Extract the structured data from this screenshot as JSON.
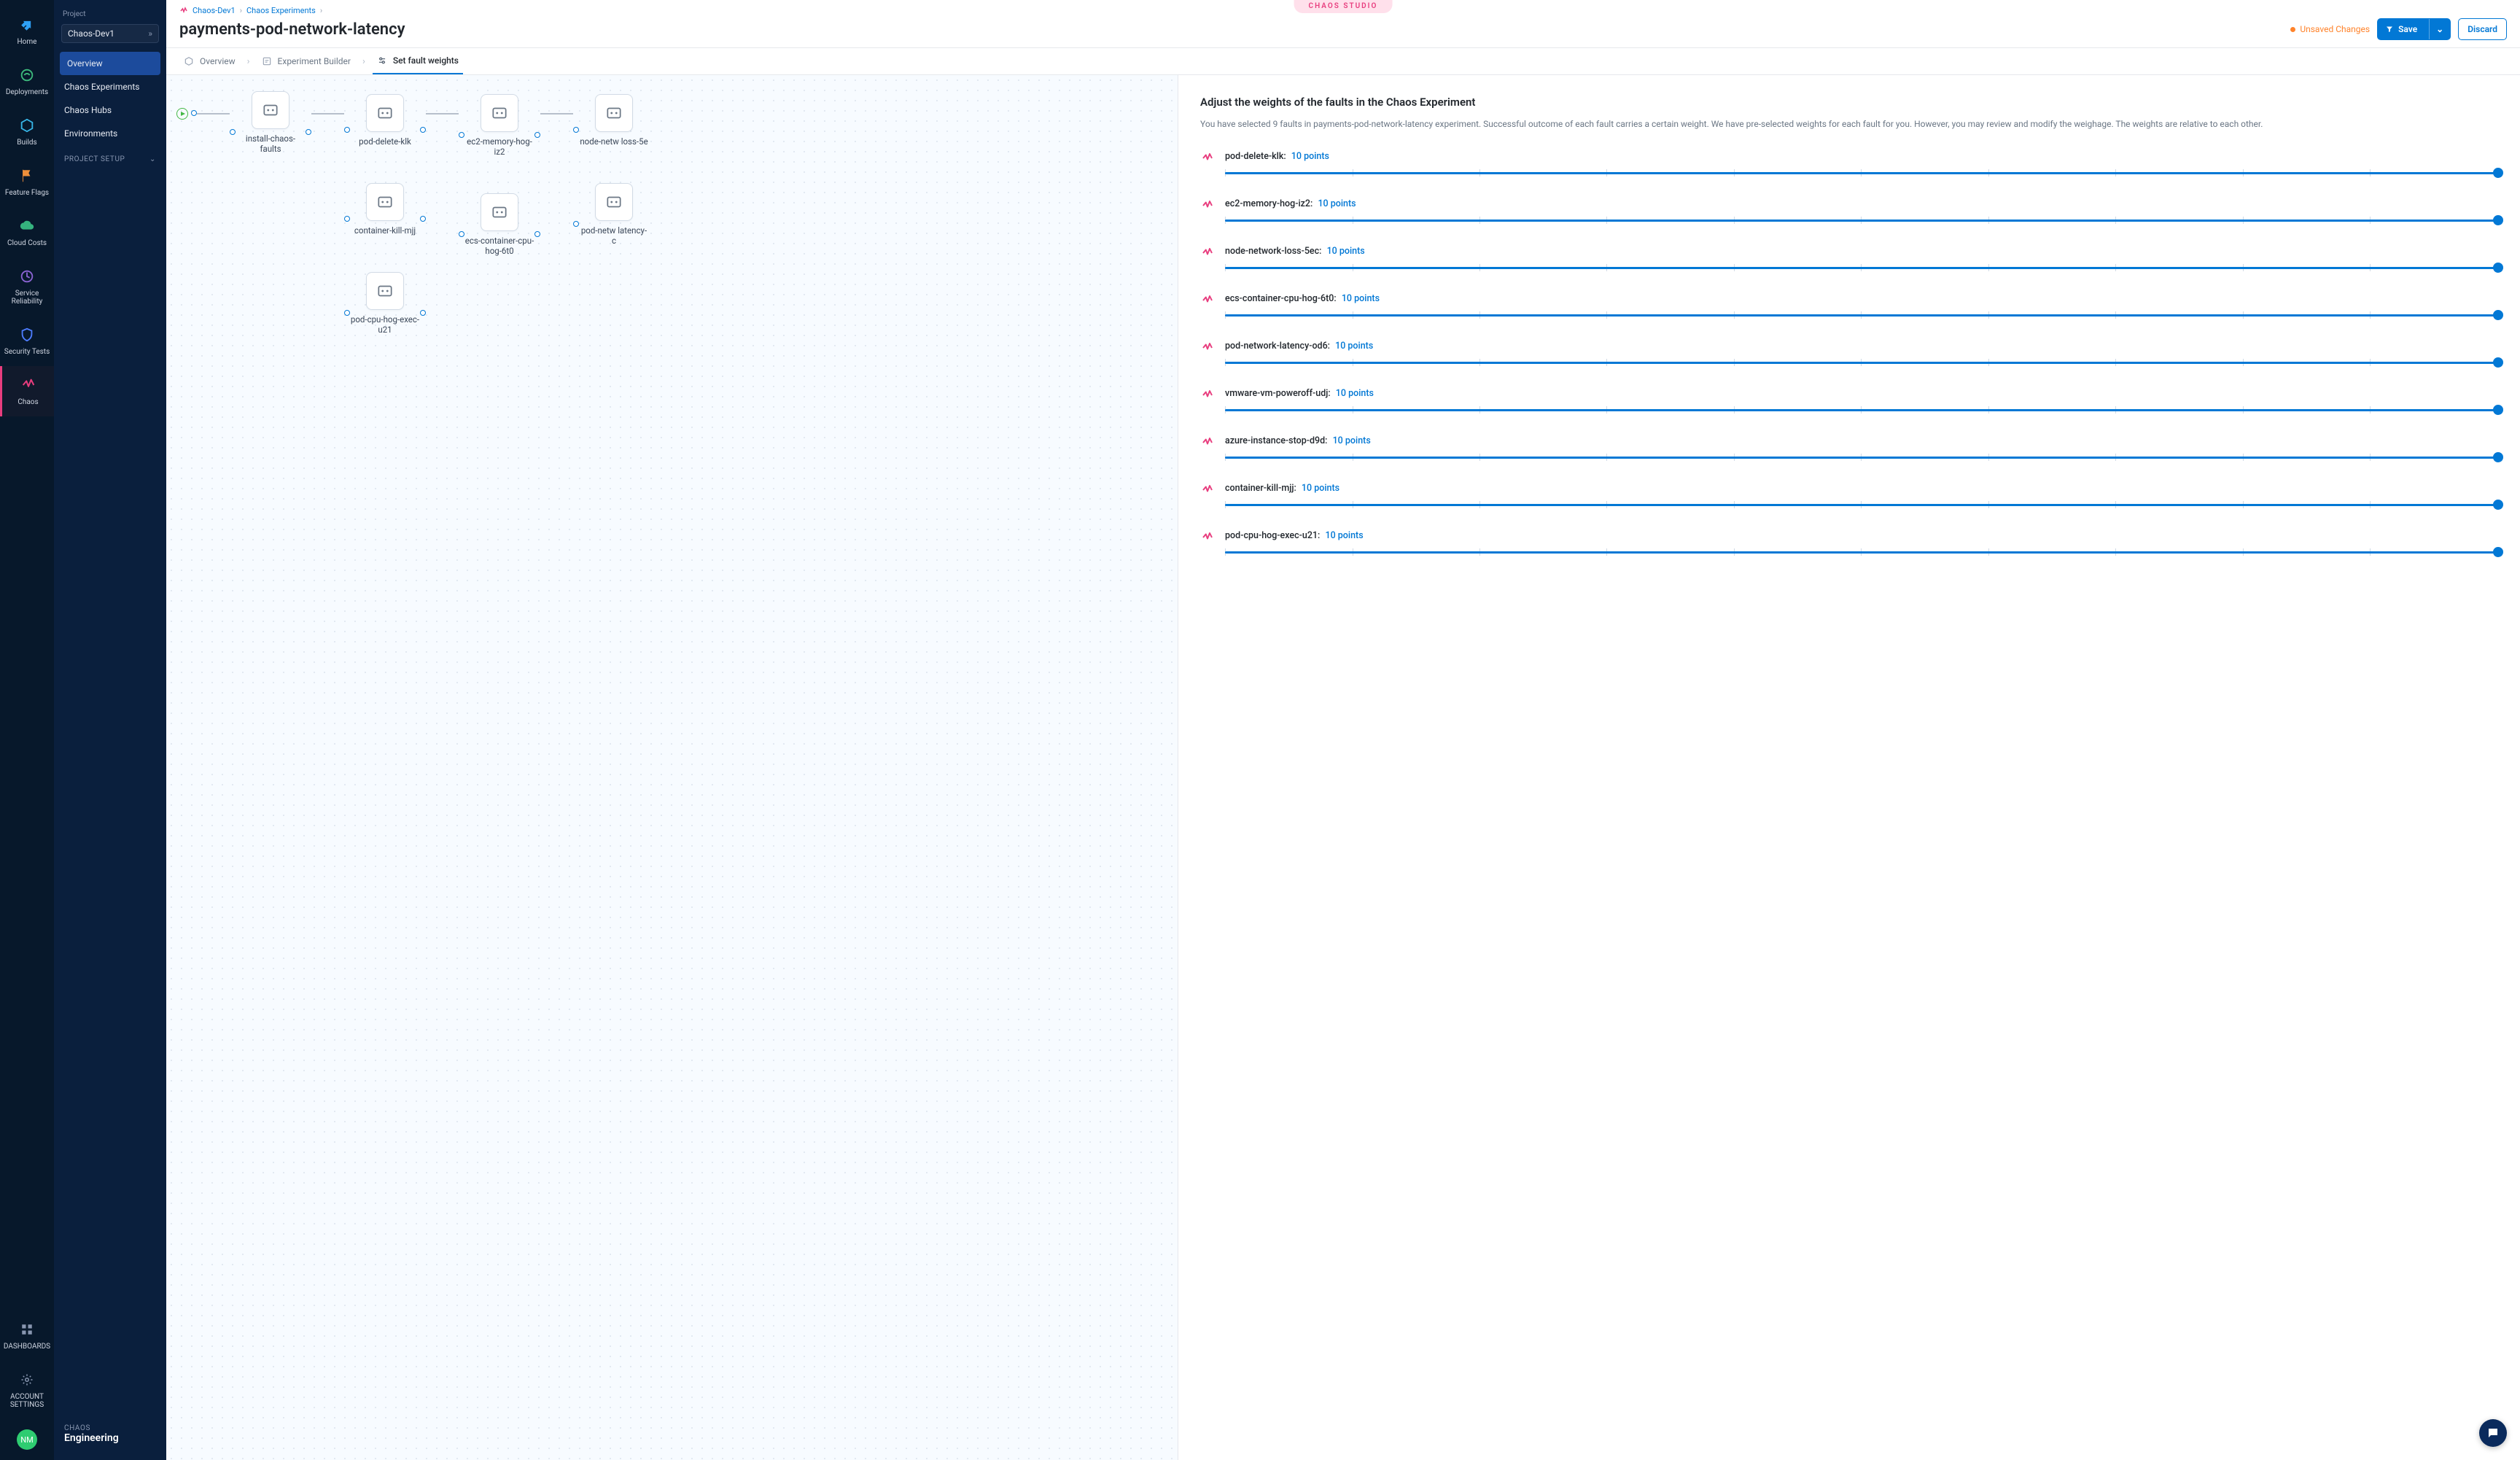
{
  "brand_pill": "CHAOS STUDIO",
  "rail": {
    "items": [
      {
        "label": "Home",
        "icon": "home"
      },
      {
        "label": "Deployments",
        "icon": "deployments"
      },
      {
        "label": "Builds",
        "icon": "builds"
      },
      {
        "label": "Feature Flags",
        "icon": "feature-flags"
      },
      {
        "label": "Cloud Costs",
        "icon": "cloud-costs"
      },
      {
        "label": "Service Reliability",
        "icon": "service-reliability"
      },
      {
        "label": "Security Tests",
        "icon": "security-tests"
      },
      {
        "label": "Chaos",
        "icon": "chaos",
        "active": true
      }
    ],
    "bottom": [
      {
        "label": "DASHBOARDS",
        "icon": "dashboards"
      },
      {
        "label": "ACCOUNT SETTINGS",
        "icon": "settings"
      }
    ],
    "avatar": "NM"
  },
  "sidebar": {
    "project_label": "Project",
    "project_value": "Chaos-Dev1",
    "nav": [
      {
        "label": "Overview",
        "selected": true
      },
      {
        "label": "Chaos Experiments"
      },
      {
        "label": "Chaos Hubs"
      },
      {
        "label": "Environments"
      }
    ],
    "setup_label": "PROJECT SETUP",
    "footer_kicker": "CHAOS",
    "footer_name": "Engineering"
  },
  "breadcrumbs": [
    {
      "label": "Chaos-Dev1"
    },
    {
      "label": "Chaos Experiments"
    }
  ],
  "page_title": "payments-pod-network-latency",
  "unsaved_label": "Unsaved Changes",
  "buttons": {
    "save": "Save",
    "discard": "Discard"
  },
  "tabs": [
    {
      "label": "Overview",
      "icon": "hex"
    },
    {
      "label": "Experiment Builder",
      "icon": "builder"
    },
    {
      "label": "Set fault weights",
      "icon": "sliders",
      "active": true
    }
  ],
  "canvas_nodes": {
    "col0": [
      "install-chaos-faults"
    ],
    "col1": [
      "pod-delete-klk",
      "container-kill-mjj",
      "pod-cpu-hog-exec-u21"
    ],
    "col2": [
      "ec2-memory-hog-iz2",
      "ecs-container-cpu-hog-6t0"
    ],
    "col3": [
      "node-netw loss-5e",
      "pod-netw latency-c"
    ]
  },
  "panel": {
    "heading": "Adjust the weights of the faults in the Chaos Experiment",
    "description": "You have selected 9 faults in payments-pod-network-latency experiment. Successful outcome of each fault carries a certain weight. We have pre-selected weights for each fault for you. However, you may review and modify the weighage. The weights are relative to each other.",
    "faults": [
      {
        "name": "pod-delete-klk",
        "points": "10 points"
      },
      {
        "name": "ec2-memory-hog-iz2",
        "points": "10 points"
      },
      {
        "name": "node-network-loss-5ec",
        "points": "10 points"
      },
      {
        "name": "ecs-container-cpu-hog-6t0",
        "points": "10 points"
      },
      {
        "name": "pod-network-latency-od6",
        "points": "10 points"
      },
      {
        "name": "vmware-vm-poweroff-udj",
        "points": "10 points"
      },
      {
        "name": "azure-instance-stop-d9d",
        "points": "10 points"
      },
      {
        "name": "container-kill-mjj",
        "points": "10 points"
      },
      {
        "name": "pod-cpu-hog-exec-u21",
        "points": "10 points"
      }
    ]
  }
}
